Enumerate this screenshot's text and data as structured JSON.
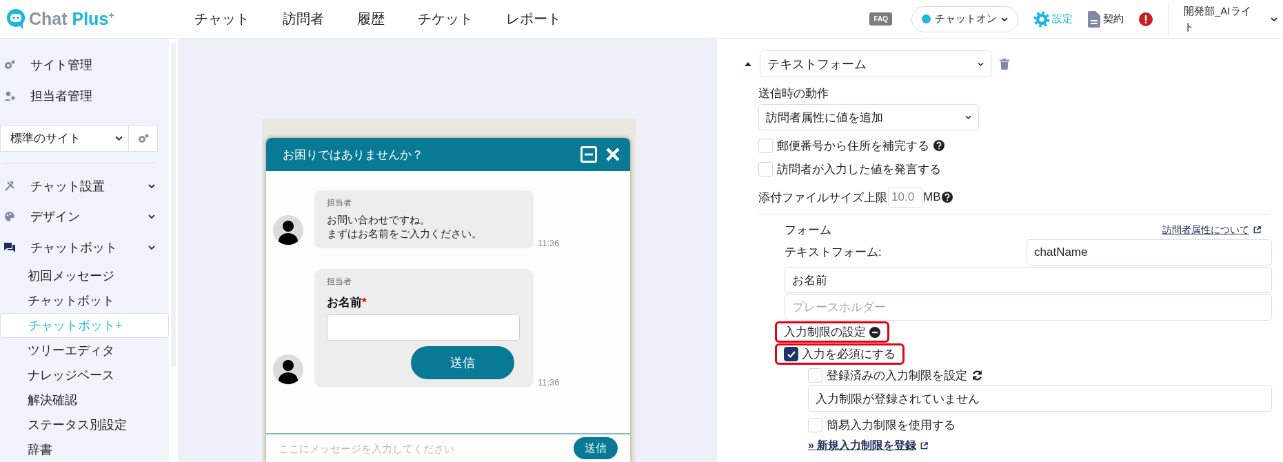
{
  "header": {
    "logo": {
      "text": "Chat Plus",
      "mark": "+"
    },
    "nav": [
      {
        "label": "チャット"
      },
      {
        "label": "訪問者"
      },
      {
        "label": "履歴"
      },
      {
        "label": "チケット"
      },
      {
        "label": "レポート"
      }
    ],
    "faq": "FAQ",
    "chat_status": {
      "label": "チャットオン",
      "on": true
    },
    "settings": "設定",
    "contract": "契約",
    "user": "開発部_AIライト"
  },
  "sidebar": {
    "top_items": [
      {
        "label": "サイト管理",
        "kind": "site"
      },
      {
        "label": "担当者管理",
        "kind": "staff"
      }
    ],
    "site_select": "標準のサイト",
    "menu": [
      {
        "label": "チャット設置",
        "kind": "tools"
      },
      {
        "label": "デザイン",
        "kind": "palette"
      },
      {
        "label": "チャットボット",
        "kind": "chat",
        "children": [
          {
            "label": "初回メッセージ",
            "selected": false
          },
          {
            "label": "チャットボット",
            "selected": false
          },
          {
            "label": "チャットボット+",
            "selected": true
          },
          {
            "label": "ツリーエディタ",
            "selected": false
          },
          {
            "label": "ナレッジベース",
            "selected": false
          },
          {
            "label": "解決確認",
            "selected": false
          },
          {
            "label": "ステータス別設定",
            "selected": false
          },
          {
            "label": "辞書",
            "selected": false
          }
        ]
      }
    ]
  },
  "chat_preview": {
    "title": "お困りではありませんか？",
    "messages": [
      {
        "kind": "text",
        "sender": "担当者",
        "lines": [
          "お問い合わせですね。",
          "まずはお名前をご入力ください。"
        ],
        "time": "11:36"
      },
      {
        "kind": "form",
        "sender": "担当者",
        "field_label": "お名前",
        "required_mark": "*",
        "button": "送信",
        "time": "11:36"
      }
    ],
    "input_placeholder": "ここにメッセージを入力してください",
    "send": "送信"
  },
  "editor": {
    "element_select": "テキストフォーム",
    "action_label": "送信時の動作",
    "action_select": "訪問者属性に値を追加",
    "options": [
      {
        "label": "郵便番号から住所を補完する",
        "checked": false,
        "help": true
      },
      {
        "label": "訪問者が入力した値を発言する",
        "checked": false,
        "help": false
      }
    ],
    "file_size": {
      "label": "添付ファイルサイズ上限",
      "value": "10.0",
      "unit": "MB"
    },
    "form": {
      "title": "フォーム",
      "link": "訪問者属性について",
      "field_label": "テキストフォーム:",
      "attribute": "chatName",
      "label_value": "お名前",
      "placeholder": "プレースホルダー",
      "restriction": {
        "label": "入力制限の設定",
        "highlighted": true
      },
      "required": {
        "label": "入力を必須にする",
        "checked": true,
        "highlighted": true
      },
      "registered": {
        "label": "登録済みの入力制限を設定",
        "checked": false
      },
      "registered_value": "入力制限が登録されていません",
      "simple": {
        "label": "簡易入力制限を使用する",
        "checked": false
      },
      "new_link": "» 新規入力制限を登録"
    }
  }
}
